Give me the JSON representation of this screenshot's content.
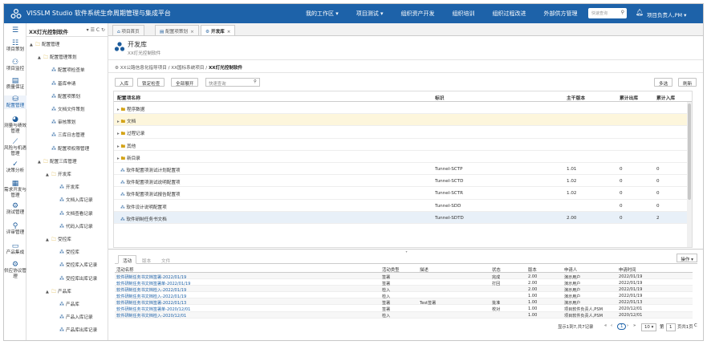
{
  "topbar": {
    "title": "VISSLM Studio 软件系统生命周期管理与集成平台",
    "nav": [
      "我的工作区 ▾",
      "项目测试 ▾",
      "组织资产开发",
      "组织培训",
      "组织过程改进",
      "外部供方管理"
    ],
    "search_placeholder": "快速查询",
    "user": "项目负责人,PM ▾"
  },
  "rail": [
    {
      "icon": "menu-icon",
      "glyph": "☰",
      "label": ""
    },
    {
      "icon": "project-plan-icon",
      "glyph": "☷",
      "label": "项目策划"
    },
    {
      "icon": "binoculars-icon",
      "glyph": "⚇",
      "label": "项目监控"
    },
    {
      "icon": "book-icon",
      "glyph": "▤",
      "label": "质量保证"
    },
    {
      "icon": "database-icon",
      "glyph": "⛁",
      "label": "配置管理"
    },
    {
      "icon": "pie-chart-icon",
      "glyph": "◕",
      "label": "测量与绩效管理"
    },
    {
      "icon": "line-chart-icon",
      "glyph": "⟋",
      "label": "风险与机遇管理"
    },
    {
      "icon": "check-icon",
      "glyph": "✓",
      "label": "决策分析"
    },
    {
      "icon": "requirements-icon",
      "glyph": "▦",
      "label": "需求开发与管理"
    },
    {
      "icon": "gear-icon",
      "glyph": "⚙",
      "label": "测试管理"
    },
    {
      "icon": "magnifier-icon",
      "glyph": "⚲",
      "label": "评审管理"
    },
    {
      "icon": "monitor-icon",
      "glyph": "▭",
      "label": "产品集成"
    },
    {
      "icon": "gears-icon",
      "glyph": "⚙",
      "label": "供应协议管理"
    }
  ],
  "tree": {
    "title": "XX灯光控制软件",
    "tools": "▾ ☰ C ↻",
    "nodes": [
      {
        "label": "配置管理",
        "level": 0,
        "toggle": "▲",
        "kind": "folder"
      },
      {
        "label": "配置管理策划",
        "level": 1,
        "toggle": "▲",
        "kind": "folder"
      },
      {
        "label": "配置项检查单",
        "level": 2,
        "toggle": "",
        "kind": "node"
      },
      {
        "label": "基库申请",
        "level": 2,
        "toggle": "",
        "kind": "node"
      },
      {
        "label": "配置项策划",
        "level": 2,
        "toggle": "",
        "kind": "node"
      },
      {
        "label": "文档文件策划",
        "level": 2,
        "toggle": "",
        "kind": "node"
      },
      {
        "label": "审核策划",
        "level": 2,
        "toggle": "",
        "kind": "node"
      },
      {
        "label": "三库日志管理",
        "level": 2,
        "toggle": "",
        "kind": "node"
      },
      {
        "label": "配置项权限管理",
        "level": 2,
        "toggle": "",
        "kind": "node"
      },
      {
        "label": "配置三库管理",
        "level": 1,
        "toggle": "▲",
        "kind": "folder"
      },
      {
        "label": "开发库",
        "level": 2,
        "toggle": "▲",
        "kind": "folder"
      },
      {
        "label": "开发库",
        "level": 3,
        "toggle": "",
        "kind": "node"
      },
      {
        "label": "文档入库记录",
        "level": 3,
        "toggle": "",
        "kind": "node"
      },
      {
        "label": "文档查看记录",
        "level": 3,
        "toggle": "",
        "kind": "node"
      },
      {
        "label": "代码入库记录",
        "level": 3,
        "toggle": "",
        "kind": "node"
      },
      {
        "label": "受控库",
        "level": 2,
        "toggle": "▲",
        "kind": "folder"
      },
      {
        "label": "受控库",
        "level": 3,
        "toggle": "",
        "kind": "node"
      },
      {
        "label": "受控库入库记录",
        "level": 3,
        "toggle": "",
        "kind": "node"
      },
      {
        "label": "受控库出库记录",
        "level": 3,
        "toggle": "",
        "kind": "node"
      },
      {
        "label": "产品库",
        "level": 2,
        "toggle": "▲",
        "kind": "folder"
      },
      {
        "label": "产品库",
        "level": 3,
        "toggle": "",
        "kind": "node"
      },
      {
        "label": "产品入库记录",
        "level": 3,
        "toggle": "",
        "kind": "node"
      },
      {
        "label": "产品库出库记录",
        "level": 3,
        "toggle": "",
        "kind": "node"
      }
    ]
  },
  "tabs": [
    {
      "label": "项目首页",
      "active": false
    },
    {
      "label": "配置项策划",
      "active": false
    },
    {
      "label": "开发库",
      "active": true
    }
  ],
  "page": {
    "title": "开发库",
    "subtitle": "XX灯光控制软件"
  },
  "breadcrumb": {
    "parts": [
      "XX公路信息化指导项目",
      "XX国标系统项目"
    ],
    "current": "XX灯光控制软件"
  },
  "toolbar": {
    "checkin": "入库",
    "lock": "锁定检查",
    "expand_all": "全部展开",
    "search_placeholder": "快速查询",
    "multi": "多选",
    "refresh": "刷新"
  },
  "grid": {
    "columns": [
      "配置项名称",
      "标识",
      "主干版本",
      "累计出库",
      "累计入库"
    ],
    "rows": [
      {
        "name": "程序数据",
        "kind": "folder",
        "id": "",
        "ver": "",
        "out": "",
        "in": "",
        "state": ""
      },
      {
        "name": "文档",
        "kind": "folder",
        "id": "",
        "ver": "",
        "out": "",
        "in": "",
        "state": "sel"
      },
      {
        "name": "过程记录",
        "kind": "folder",
        "id": "",
        "ver": "",
        "out": "",
        "in": "",
        "state": ""
      },
      {
        "name": "其他",
        "kind": "folder",
        "id": "",
        "ver": "",
        "out": "",
        "in": "",
        "state": ""
      },
      {
        "name": "新目录",
        "kind": "folder",
        "id": "",
        "ver": "",
        "out": "",
        "in": "",
        "state": ""
      },
      {
        "name": "软件配置项测试计划配置项",
        "kind": "node",
        "id": "Tunnel-SCTP",
        "ver": "1.01",
        "out": "0",
        "in": "0",
        "state": ""
      },
      {
        "name": "软件配置项测试说明配置项",
        "kind": "node",
        "id": "Tunnel-SCTD",
        "ver": "1.02",
        "out": "0",
        "in": "0",
        "state": ""
      },
      {
        "name": "软件配置项测试报告配置项",
        "kind": "node",
        "id": "Tunnel-SCTR",
        "ver": "1.02",
        "out": "0",
        "in": "0",
        "state": ""
      },
      {
        "name": "软件设计说明配置项",
        "kind": "node",
        "id": "Tunnel-SDD",
        "ver": "",
        "out": "0",
        "in": "0",
        "state": ""
      },
      {
        "name": "软件研制任务书文档",
        "kind": "node",
        "id": "Tunnel-SDTD",
        "ver": "2.00",
        "out": "0",
        "in": "2",
        "state": "hl"
      }
    ]
  },
  "bottom": {
    "tabs": [
      {
        "label": "活动",
        "active": true
      },
      {
        "label": "版本",
        "active": false
      },
      {
        "label": "文件",
        "active": false
      }
    ],
    "ops": "操作 ▾",
    "columns": [
      "活动名称",
      "活动类型",
      "描述",
      "状态",
      "版本",
      "申请人",
      "申请时间"
    ],
    "rows": [
      [
        "软件研制任务书文档签署-2022/01/19",
        "签署",
        "",
        "完成",
        "2.00",
        "演示用户",
        "2022/01/19"
      ],
      [
        "软件研制任务书文档签署单-2022/01/19",
        "签署",
        "",
        "打回",
        "2.00",
        "演示用户",
        "2022/01/19"
      ],
      [
        "软件研制任务书文档检入-2022/01/19",
        "检入",
        "",
        "",
        "2.00",
        "演示用户",
        "2022/01/19"
      ],
      [
        "软件研制任务书文档检入-2022/01/19",
        "检入",
        "",
        "",
        "1.00",
        "演示用户",
        "2022/01/19"
      ],
      [
        "软件研制任务书文档签署-2022/01/13",
        "签署",
        "Test签署",
        "批准",
        "1.00",
        "演示用户",
        "2022/01/13"
      ],
      [
        "软件研制任务书文档签署单-2020/12/01",
        "签署",
        "",
        "校对",
        "1.00",
        "项目软件负责人,PSM",
        "2020/12/01"
      ],
      [
        "软件研制任务书文档检入-2020/12/01",
        "检入",
        "",
        "",
        "1.00",
        "项目软件负责人,PSM",
        "2020/12/01"
      ]
    ],
    "pager": {
      "summary": "显示1到7,共7记录",
      "first": "«",
      "prev": "‹",
      "page": "1",
      "next": "›",
      "last": "»",
      "size": "10 ▾",
      "go_label": "第",
      "go_value": "1",
      "total": "页共1页",
      "ok": "C"
    }
  }
}
